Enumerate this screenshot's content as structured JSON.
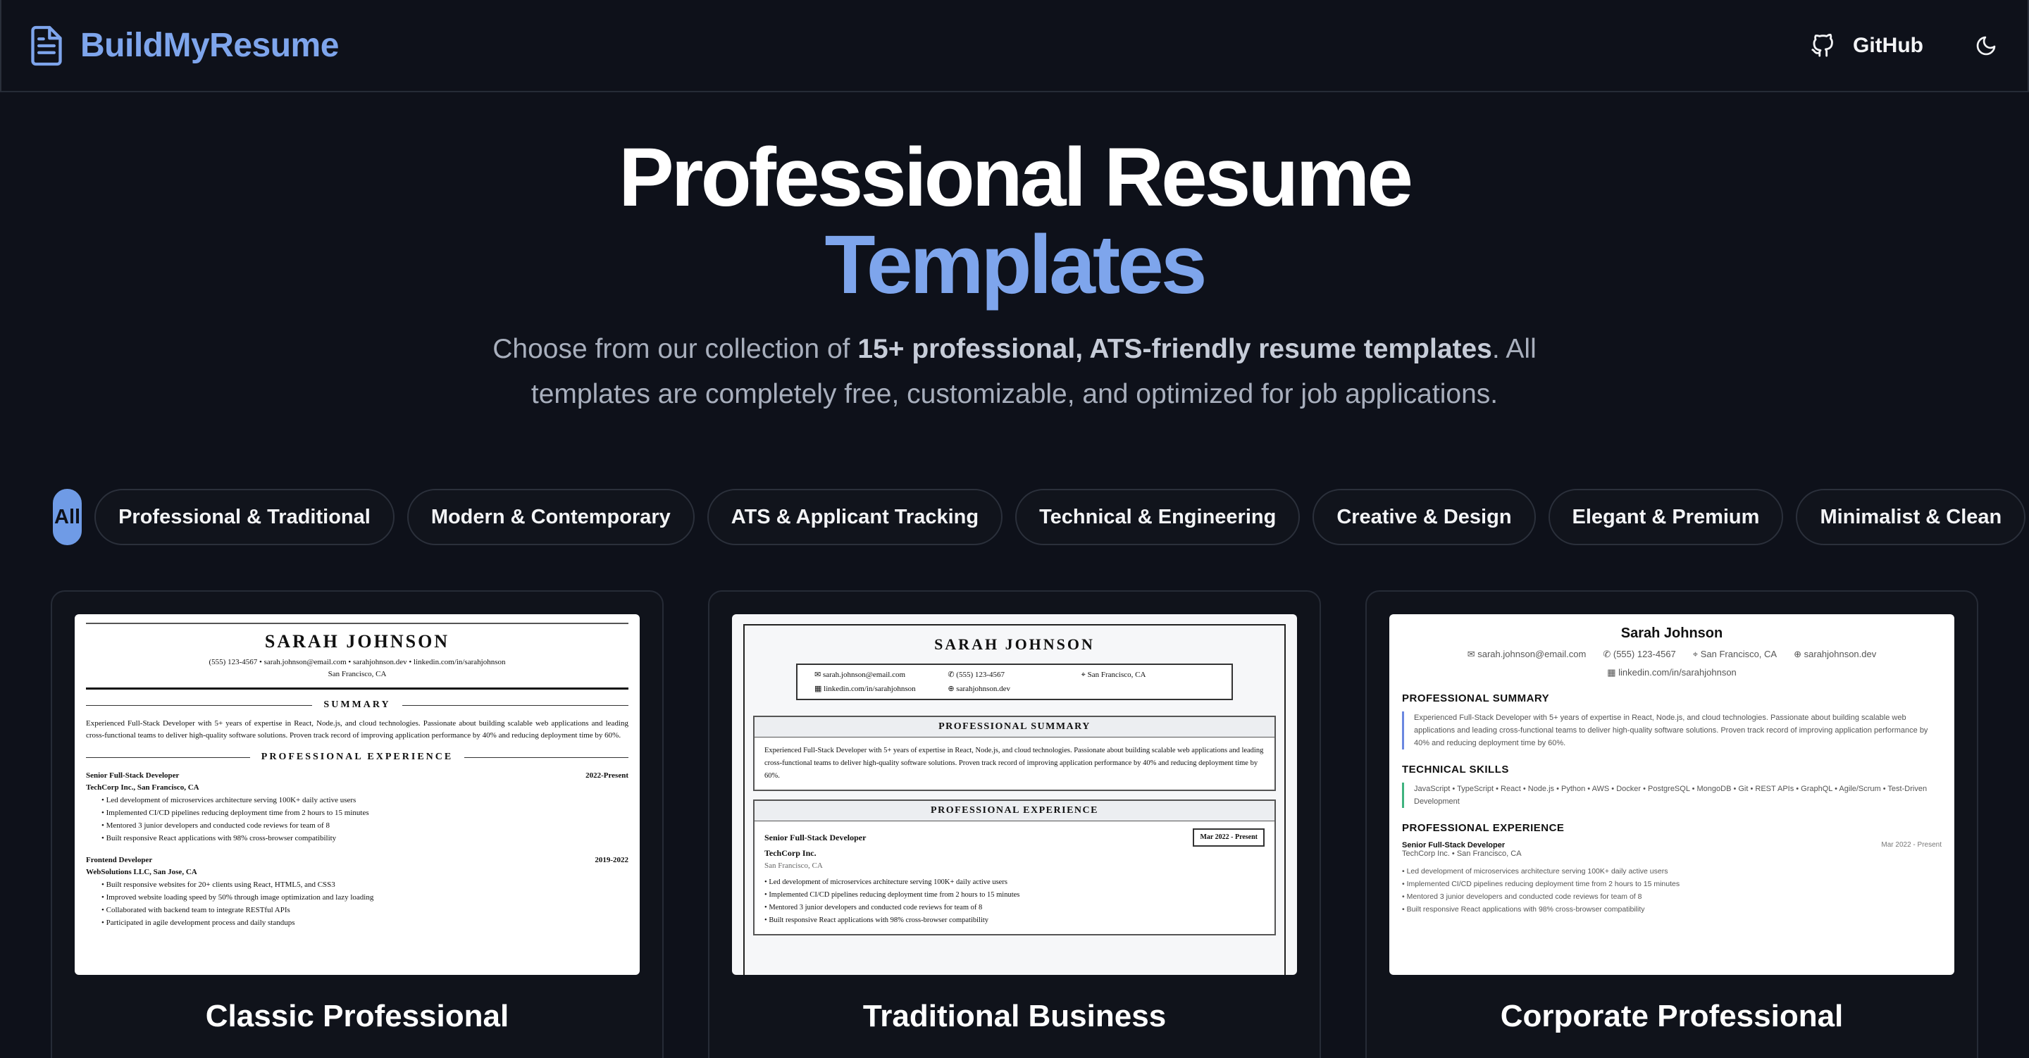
{
  "navbar": {
    "brand": "BuildMyResume",
    "github_label": "GitHub",
    "theme_toggle_icon": "moon-icon"
  },
  "hero": {
    "title_line1": "Professional Resume",
    "title_line2": "Templates",
    "subtitle_pre": "Choose from our collection of ",
    "subtitle_bold": "15+ professional, ATS-friendly resume templates",
    "subtitle_post": ". All templates are completely free, customizable, and optimized for job applications."
  },
  "filters": [
    {
      "label": "All",
      "active": true
    },
    {
      "label": "Professional & Traditional",
      "active": false
    },
    {
      "label": "Modern & Contemporary",
      "active": false
    },
    {
      "label": "ATS & Applicant Tracking",
      "active": false
    },
    {
      "label": "Technical & Engineering",
      "active": false
    },
    {
      "label": "Creative & Design",
      "active": false
    },
    {
      "label": "Elegant & Premium",
      "active": false
    },
    {
      "label": "Minimalist & Clean",
      "active": false
    }
  ],
  "cards": [
    {
      "title": "Classic Professional",
      "preview": {
        "name": "SARAH JOHNSON",
        "contact": "(555) 123-4567 • sarah.johnson@email.com • sarahjohnson.dev • linkedin.com/in/sarahjohnson",
        "location": "San Francisco, CA",
        "summary_heading": "SUMMARY",
        "summary": "Experienced Full-Stack Developer with 5+ years of expertise in React, Node.js, and cloud technologies. Passionate about building scalable web applications and leading cross-functional teams to deliver high-quality software solutions. Proven track record of improving application performance by 40% and reducing deployment time by 60%.",
        "experience_heading": "PROFESSIONAL EXPERIENCE",
        "jobs": [
          {
            "role": "Senior Full-Stack Developer",
            "dates": "2022-Present",
            "company": "TechCorp Inc., San Francisco, CA",
            "bullets": [
              "Led development of microservices architecture serving 100K+ daily active users",
              "Implemented CI/CD pipelines reducing deployment time from 2 hours to 15 minutes",
              "Mentored 3 junior developers and conducted code reviews for team of 8",
              "Built responsive React applications with 98% cross-browser compatibility"
            ]
          },
          {
            "role": "Frontend Developer",
            "dates": "2019-2022",
            "company": "WebSolutions LLC, San Jose, CA",
            "bullets": [
              "Built responsive websites for 20+ clients using React, HTML5, and CSS3",
              "Improved website loading speed by 50% through image optimization and lazy loading",
              "Collaborated with backend team to integrate RESTful APIs",
              "Participated in agile development process and daily standups"
            ]
          }
        ]
      }
    },
    {
      "title": "Traditional Business",
      "preview": {
        "name": "SARAH JOHNSON",
        "email": "sarah.johnson@email.com",
        "phone": "(555) 123-4567",
        "location": "San Francisco, CA",
        "linkedin": "linkedin.com/in/sarahjohnson",
        "website": "sarahjohnson.dev",
        "summary_heading": "PROFESSIONAL SUMMARY",
        "summary": "Experienced Full-Stack Developer with 5+ years of expertise in React, Node.js, and cloud technologies. Passionate about building scalable web applications and leading cross-functional teams to deliver high-quality software solutions. Proven track record of improving application performance by 40% and reducing deployment time by 60%.",
        "experience_heading": "PROFESSIONAL EXPERIENCE",
        "job_role": "Senior Full-Stack Developer",
        "job_dates": "Mar 2022 - Present",
        "job_company": "TechCorp Inc.",
        "job_location": "San Francisco, CA",
        "bullets": [
          "Led development of microservices architecture serving 100K+ daily active users",
          "Implemented CI/CD pipelines reducing deployment time from 2 hours to 15 minutes",
          "Mentored 3 junior developers and conducted code reviews for team of 8",
          "Built responsive React applications with 98% cross-browser compatibility"
        ]
      }
    },
    {
      "title": "Corporate Professional",
      "preview": {
        "name": "Sarah Johnson",
        "email": "sarah.johnson@email.com",
        "phone": "(555) 123-4567",
        "location": "San Francisco, CA",
        "website": "sarahjohnson.dev",
        "linkedin": "linkedin.com/in/sarahjohnson",
        "summary_heading": "PROFESSIONAL SUMMARY",
        "summary": "Experienced Full-Stack Developer with 5+ years of expertise in React, Node.js, and cloud technologies. Passionate about building scalable web applications and leading cross-functional teams to deliver high-quality software solutions. Proven track record of improving application performance by 40% and reducing deployment time by 60%.",
        "skills_heading": "TECHNICAL SKILLS",
        "skills": "JavaScript • TypeScript • React • Node.js • Python • AWS • Docker • PostgreSQL • MongoDB • Git • REST APIs • GraphQL • Agile/Scrum • Test-Driven Development",
        "experience_heading": "PROFESSIONAL EXPERIENCE",
        "job_role": "Senior Full-Stack Developer",
        "job_dates": "Mar 2022 - Present",
        "job_company": "TechCorp Inc. • San Francisco, CA",
        "bullets": [
          "Led development of microservices architecture serving 100K+ daily active users",
          "Implemented CI/CD pipelines reducing deployment time from 2 hours to 15 minutes",
          "Mentored 3 junior developers and conducted code reviews for team of 8",
          "Built responsive React applications with 98% cross-browser compatibility"
        ]
      }
    }
  ]
}
